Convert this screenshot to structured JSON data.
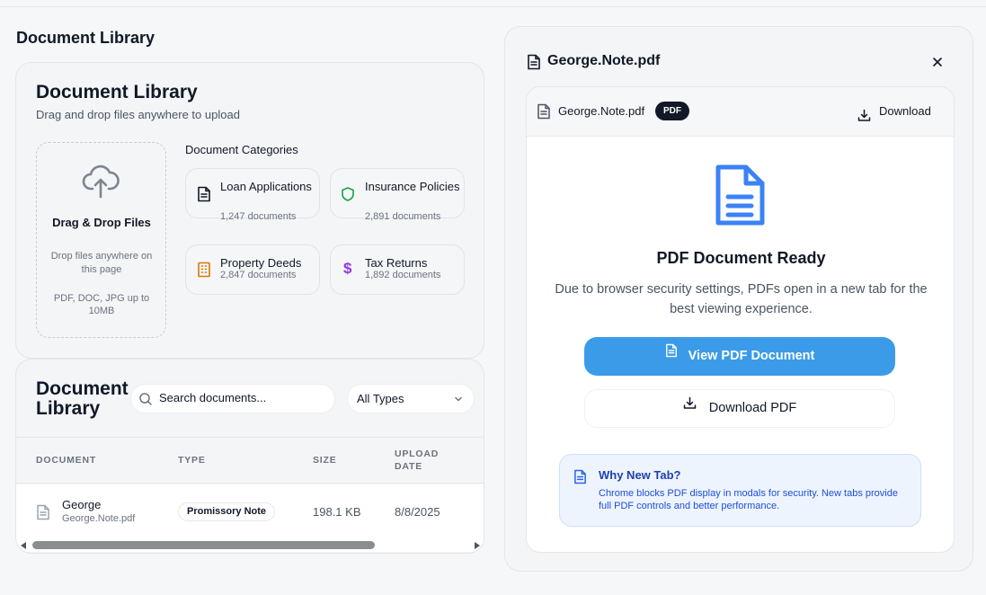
{
  "page": {
    "title": "Document Library"
  },
  "upload": {
    "title": "Document Library",
    "subtitle": "Drag and drop files anywhere to upload",
    "dropzone_title": "Drag & Drop Files",
    "dropzone_hint": "Drop files anywhere on this page",
    "dropzone_formats": "PDF, DOC, JPG up to 10MB",
    "icon": "cloud-upload-icon"
  },
  "categories": {
    "heading": "Document Categories",
    "items": [
      {
        "name": "Loan Applications",
        "count": "1,247 documents",
        "icon": "file-text-icon",
        "color": "#111827"
      },
      {
        "name": "Insurance Policies",
        "count": "2,891 documents",
        "icon": "shield-icon",
        "color": "#16a34a"
      },
      {
        "name": "Property Deeds",
        "count": "2,847 documents",
        "icon": "building-icon",
        "color": "#d97706"
      },
      {
        "name": "Tax Returns",
        "count": "1,892 documents",
        "icon": "dollar-icon",
        "color": "#9333ea"
      }
    ]
  },
  "library": {
    "title": "Document Library",
    "search_placeholder": "Search documents...",
    "filter_value": "All Types",
    "columns": [
      "DOCUMENT",
      "TYPE",
      "SIZE",
      "UPLOAD DATE"
    ],
    "rows": [
      {
        "name": "George",
        "file": "George.Note.pdf",
        "type": "Promissory Note",
        "size": "198.1 KB",
        "date": "8/8/2025"
      }
    ]
  },
  "preview": {
    "title": "George.Note.pdf",
    "file_name": "George.Note.pdf",
    "badge": "PDF",
    "download_label": "Download",
    "ready_title": "PDF Document Ready",
    "ready_desc": "Due to browser security settings, PDFs open in a new tab for the best viewing experience.",
    "view_button": "View PDF Document",
    "download_button": "Download PDF",
    "why_title": "Why New Tab?",
    "why_text": "Chrome blocks PDF display in modals for security. New tabs provide full PDF controls and better performance.",
    "accent": "#3b9be8"
  }
}
